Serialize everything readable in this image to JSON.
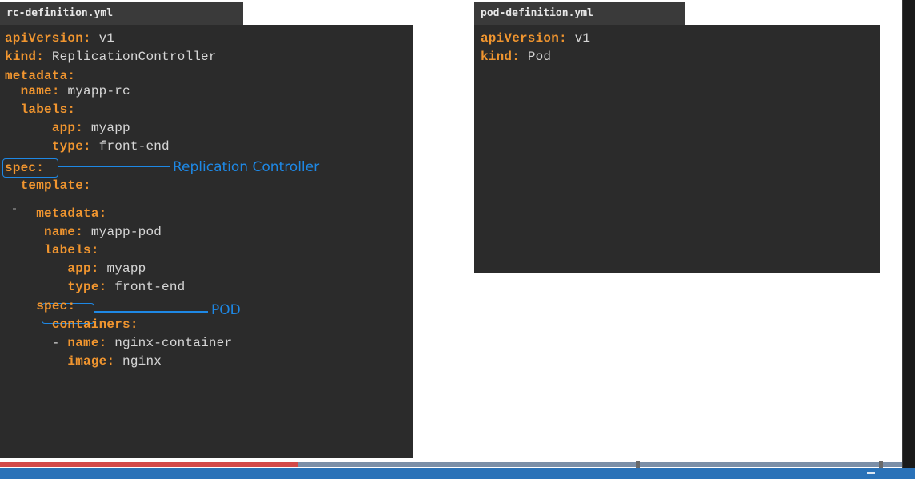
{
  "left_file": {
    "tab_label": "rc-definition.yml",
    "lines": [
      {
        "indent": "",
        "key": "apiVersion",
        "sep": ": ",
        "value": "v1"
      },
      {
        "indent": "",
        "key": "kind",
        "sep": ": ",
        "value": "ReplicationController"
      },
      {
        "indent": "",
        "key": "metadata",
        "sep": ":",
        "value": ""
      },
      {
        "indent": "  ",
        "key": "name",
        "sep": ": ",
        "value": "myapp-rc"
      },
      {
        "indent": "  ",
        "key": "labels",
        "sep": ":",
        "value": ""
      },
      {
        "indent": "      ",
        "key": "app",
        "sep": ": ",
        "value": "myapp"
      },
      {
        "indent": "      ",
        "key": "type",
        "sep": ": ",
        "value": "front-end"
      },
      {
        "indent": "",
        "key": "spec",
        "sep": ":",
        "value": ""
      },
      {
        "indent": "  ",
        "key": "template",
        "sep": ":",
        "value": ""
      },
      {
        "indent": "    ",
        "key": "metadata",
        "sep": ":",
        "value": ""
      },
      {
        "indent": "     ",
        "key": "name",
        "sep": ": ",
        "value": "myapp-pod"
      },
      {
        "indent": "     ",
        "key": "labels",
        "sep": ":",
        "value": ""
      },
      {
        "indent": "        ",
        "key": "app",
        "sep": ": ",
        "value": "myapp"
      },
      {
        "indent": "        ",
        "key": "type",
        "sep": ": ",
        "value": "front-end"
      },
      {
        "indent": "    ",
        "key": "spec",
        "sep": ":",
        "value": ""
      },
      {
        "indent": "      ",
        "key": "containers",
        "sep": ":",
        "value": ""
      },
      {
        "indent": "      - ",
        "key": "name",
        "sep": ": ",
        "value": "nginx-container"
      },
      {
        "indent": "        ",
        "key": "image",
        "sep": ": ",
        "value": "nginx"
      }
    ]
  },
  "right_file": {
    "tab_label": "pod-definition.yml",
    "lines": [
      {
        "indent": "",
        "key": "apiVersion",
        "sep": ": ",
        "value": "v1"
      },
      {
        "indent": "",
        "key": "kind",
        "sep": ": ",
        "value": "Pod"
      }
    ]
  },
  "annotations": {
    "replication_controller": "Replication Controller",
    "pod": "POD"
  },
  "player": {
    "progress_percent": 33
  },
  "colors": {
    "key": "#f0952f",
    "value": "#d6d6d6",
    "annotation": "#1e88e5",
    "progress": "#d24a49"
  }
}
